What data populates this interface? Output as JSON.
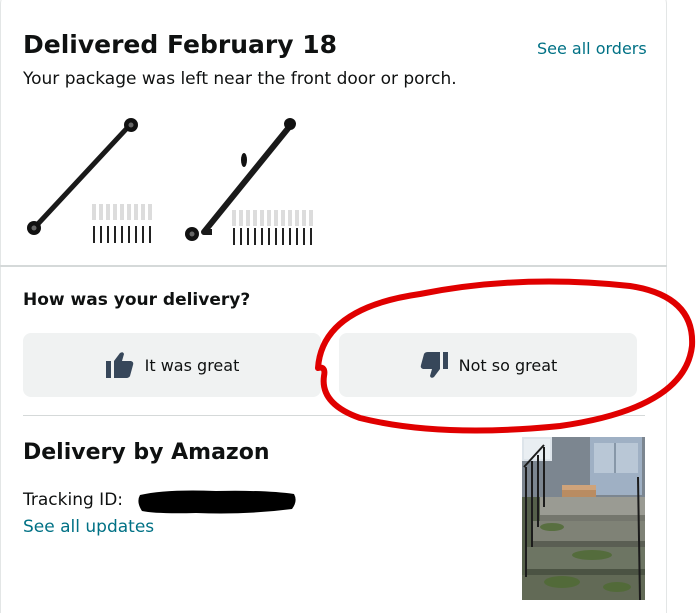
{
  "header": {
    "title": "Delivered February 18",
    "see_all_orders": "See all orders",
    "subtitle": "Your package was left near the front door or porch."
  },
  "products": [
    {
      "name": "pipe-handrail-product-image"
    },
    {
      "name": "angled-pipe-handrail-product-image"
    }
  ],
  "feedback": {
    "question": "How was your delivery?",
    "positive_label": "It was great",
    "negative_label": "Not so great",
    "positive_icon": "thumbs-up-icon",
    "negative_icon": "thumbs-down-icon"
  },
  "delivery": {
    "title": "Delivery by Amazon",
    "tracking_label": "Tracking ID:",
    "see_all_updates": "See all updates"
  },
  "colors": {
    "link": "#007185",
    "button_bg": "#f0f2f2",
    "annotation_red": "#e00000",
    "icon": "#37475a"
  }
}
